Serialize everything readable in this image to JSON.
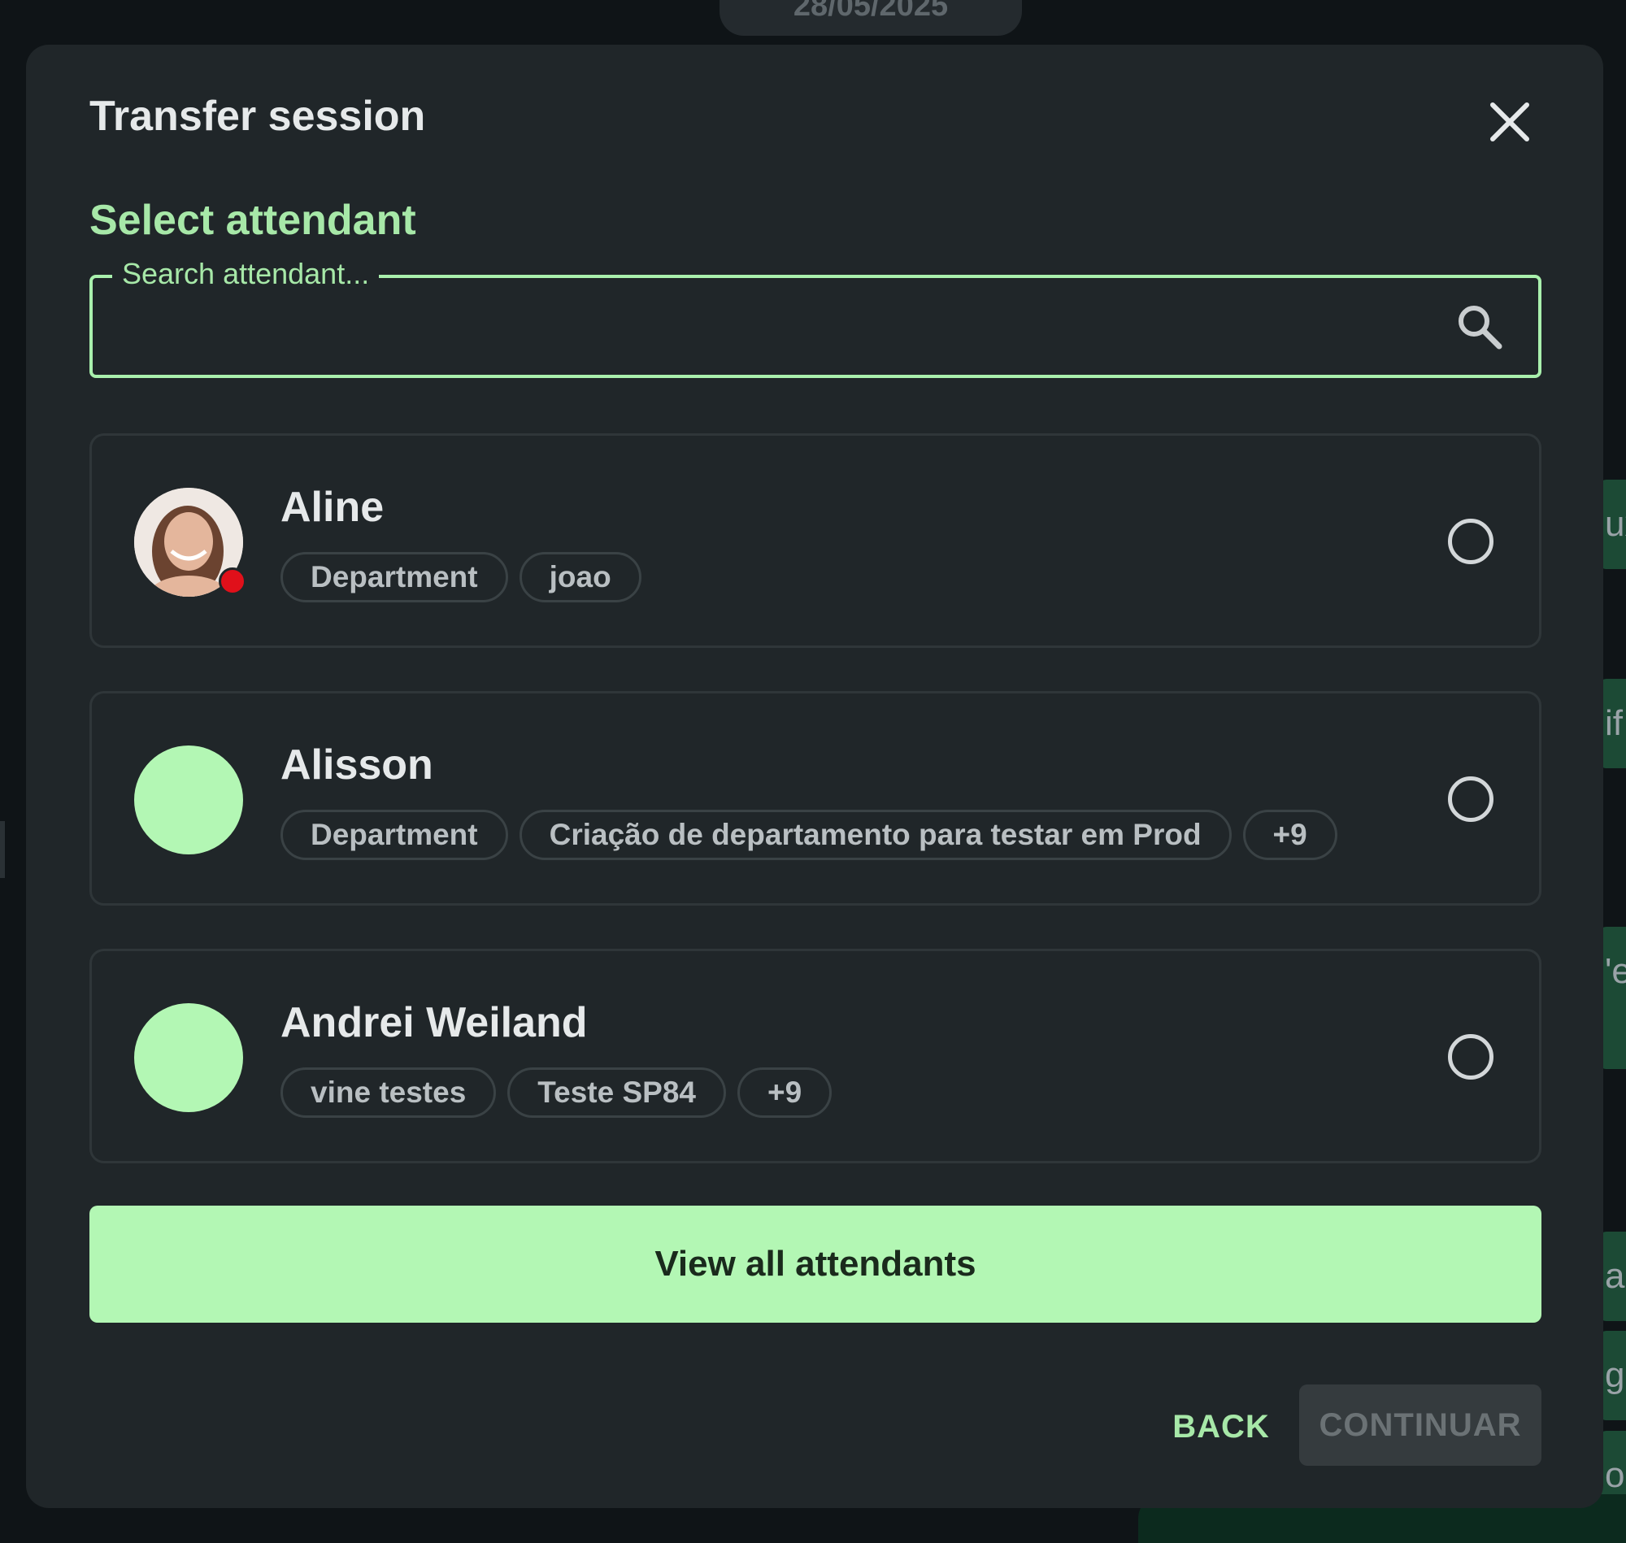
{
  "background": {
    "date_pill": "28/05/2025",
    "right_strip_fragments": [
      "ux",
      "if",
      "'e",
      "ar",
      "g",
      "o"
    ]
  },
  "modal": {
    "title": "Transfer session",
    "close_icon": "close-icon"
  },
  "section": {
    "title": "Select attendant"
  },
  "search": {
    "label": "Search attendant...",
    "value": "",
    "icon": "search-icon"
  },
  "attendants": [
    {
      "name": "Aline",
      "avatar": "photo",
      "status": "busy",
      "tags": [
        "Department",
        "joao"
      ],
      "selected": false
    },
    {
      "name": "Alisson",
      "avatar": "placeholder",
      "tags": [
        "Department",
        "Criação de departamento para testar em Prod",
        "+9"
      ],
      "selected": false
    },
    {
      "name": "Andrei Weiland",
      "avatar": "placeholder",
      "tags": [
        "vine testes",
        "Teste SP84",
        "+9"
      ],
      "selected": false
    }
  ],
  "buttons": {
    "view_all": "View all attendants",
    "back": "BACK",
    "continue": "CONTINUAR"
  },
  "colors": {
    "accent": "#a7e8a8",
    "button_fill": "#b3f7b4",
    "modal_bg": "#202629",
    "presence_busy": "#e0101a"
  }
}
